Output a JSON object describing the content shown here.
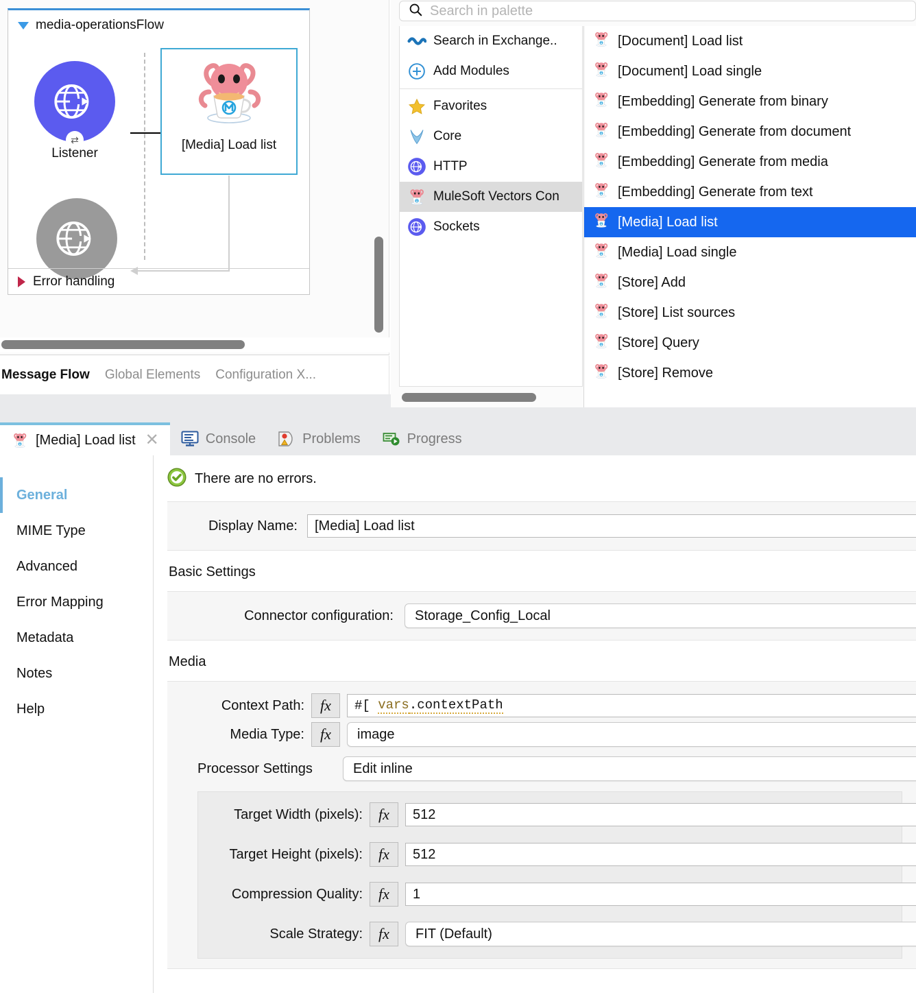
{
  "canvas": {
    "flow_name": "media-operationsFlow",
    "error_handling_label": "Error handling",
    "nodes": {
      "listener_label": "Listener",
      "listener_badge": "⇄",
      "selected_label": "[Media] Load list"
    },
    "tabs": [
      {
        "label": "Message Flow",
        "active": true
      },
      {
        "label": "Global Elements",
        "active": false
      },
      {
        "label": "Configuration X...",
        "active": false
      }
    ]
  },
  "palette": {
    "search_placeholder": "Search in palette",
    "search_value": "",
    "categories": [
      {
        "label": "Search in Exchange..",
        "icon": "exchange-icon",
        "selected": false
      },
      {
        "label": "Add Modules",
        "icon": "add-circle-icon",
        "selected": false
      },
      {
        "label": "Favorites",
        "icon": "star-icon",
        "selected": false
      },
      {
        "label": "Core",
        "icon": "core-icon",
        "selected": false
      },
      {
        "label": "HTTP",
        "icon": "http-globe-icon",
        "selected": false
      },
      {
        "label": "MuleSoft Vectors Con",
        "icon": "mule-icon",
        "selected": true
      },
      {
        "label": "Sockets",
        "icon": "sockets-globe-icon",
        "selected": false
      }
    ],
    "operations": [
      {
        "label": "[Document] Load list",
        "selected": false
      },
      {
        "label": "[Document] Load single",
        "selected": false
      },
      {
        "label": "[Embedding] Generate from binary",
        "selected": false
      },
      {
        "label": "[Embedding] Generate from document",
        "selected": false
      },
      {
        "label": "[Embedding] Generate from media",
        "selected": false
      },
      {
        "label": "[Embedding] Generate from text",
        "selected": false
      },
      {
        "label": "[Media] Load list",
        "selected": true
      },
      {
        "label": "[Media] Load single",
        "selected": false
      },
      {
        "label": "[Store] Add",
        "selected": false
      },
      {
        "label": "[Store] List sources",
        "selected": false
      },
      {
        "label": "[Store] Query",
        "selected": false
      },
      {
        "label": "[Store] Remove",
        "selected": false
      }
    ]
  },
  "properties": {
    "tabs": [
      {
        "label": "[Media] Load list",
        "icon": "mule-icon",
        "active": true,
        "closable": true
      },
      {
        "label": "Console",
        "icon": "console-icon",
        "active": false,
        "closable": false
      },
      {
        "label": "Problems",
        "icon": "problems-icon",
        "active": false,
        "closable": false
      },
      {
        "label": "Progress",
        "icon": "progress-icon",
        "active": false,
        "closable": false
      }
    ],
    "close_glyph": "✕",
    "sidebar": [
      {
        "label": "General",
        "active": true
      },
      {
        "label": "MIME Type",
        "active": false
      },
      {
        "label": "Advanced",
        "active": false
      },
      {
        "label": "Error Mapping",
        "active": false
      },
      {
        "label": "Metadata",
        "active": false
      },
      {
        "label": "Notes",
        "active": false
      },
      {
        "label": "Help",
        "active": false
      }
    ],
    "status": {
      "text": "There are no errors.",
      "icon": "success-check-icon"
    },
    "display_name": {
      "label": "Display Name:",
      "value": "[Media] Load list"
    },
    "basic_settings": {
      "title": "Basic Settings",
      "connector_config": {
        "label": "Connector configuration:",
        "value": "Storage_Config_Local"
      }
    },
    "media": {
      "title": "Media",
      "context_path": {
        "label": "Context Path:",
        "prefix": "#[",
        "value": "vars",
        "suffix": ".contextPath",
        "fx": "fx"
      },
      "media_type": {
        "label": "Media Type:",
        "value": "image",
        "fx": "fx"
      },
      "processor_settings": {
        "label": "Processor Settings",
        "value": "Edit inline"
      },
      "fields": [
        {
          "label": "Target Width (pixels):",
          "value": "512",
          "fx": "fx",
          "style": "flat"
        },
        {
          "label": "Target Height (pixels):",
          "value": "512",
          "fx": "fx",
          "style": "flat"
        },
        {
          "label": "Compression Quality:",
          "value": "1",
          "fx": "fx",
          "style": "flat"
        },
        {
          "label": "Scale Strategy:",
          "value": "FIT (Default)",
          "fx": "fx",
          "style": "round"
        }
      ]
    }
  },
  "colors": {
    "accent_blue": "#1567ef",
    "flow_header_blue": "#3b8fd6",
    "selection_teal": "#3fa9d4",
    "listener_purple": "#5b5bef",
    "sidebar_active": "#6cb0dc"
  }
}
